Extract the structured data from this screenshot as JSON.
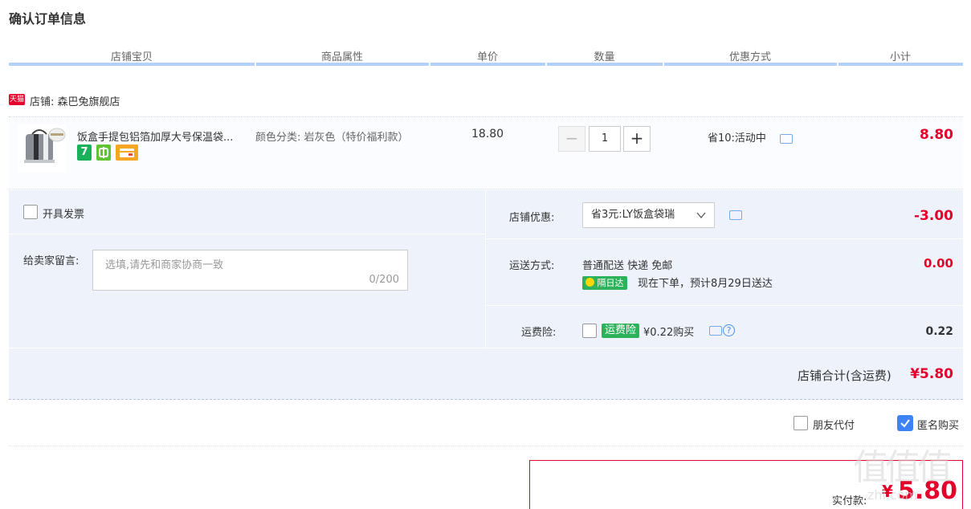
{
  "page": {
    "title": "确认订单信息"
  },
  "columns": [
    "店铺宝贝",
    "商品属性",
    "单价",
    "数量",
    "优惠方式",
    "小计"
  ],
  "shop": {
    "badge": "天猫",
    "label": "店铺: 森巴兔旗舰店"
  },
  "item": {
    "name": "饭盒手提包铝箔加厚大号保温袋...",
    "badges": [
      {
        "text": "7",
        "color": "#19b25a"
      },
      {
        "text": "",
        "color": "#61c434"
      },
      {
        "text": "",
        "color": "#f5a623"
      }
    ],
    "attribute": "颜色分类: 岩灰色（特价福利款）",
    "price": "18.80",
    "quantity": "1",
    "minus": "−",
    "plus": "+",
    "promotion": "省10:活动中",
    "subtotal": "8.80"
  },
  "invoice": {
    "label": "开具发票"
  },
  "message": {
    "label": "给卖家留言:",
    "placeholder": "选填,请先和商家协商一致",
    "counter": "0/200"
  },
  "shop_discount": {
    "label": "店铺优惠:",
    "selected": "省3元:LY饭盒袋瑞",
    "amount": "-3.00"
  },
  "shipping": {
    "label": "运送方式:",
    "method": "普通配送 快递 免邮",
    "badge": "隔日达",
    "eta": "现在下单，预计8月29日送达",
    "amount": "0.00"
  },
  "insurance": {
    "label": "运费险:",
    "badge": "运费险",
    "price": "¥0.22购买",
    "amount": "0.22"
  },
  "total": {
    "label": "店铺合计(含运费)",
    "amount": "¥5.80"
  },
  "options": {
    "friend_pay": "朋友代付",
    "anonymous": "匿名购买",
    "anonymous_checked": true
  },
  "payment": {
    "label": "实付款:",
    "amount": "5.80",
    "currency": "¥"
  },
  "watermark": {
    "text": "值值值",
    "url": "zhi.com"
  },
  "colors": {
    "accent": "#e4002b",
    "header_bar": "#b2d1ff",
    "panel": "#eef3fb",
    "checkbox": "#3e82f7"
  }
}
